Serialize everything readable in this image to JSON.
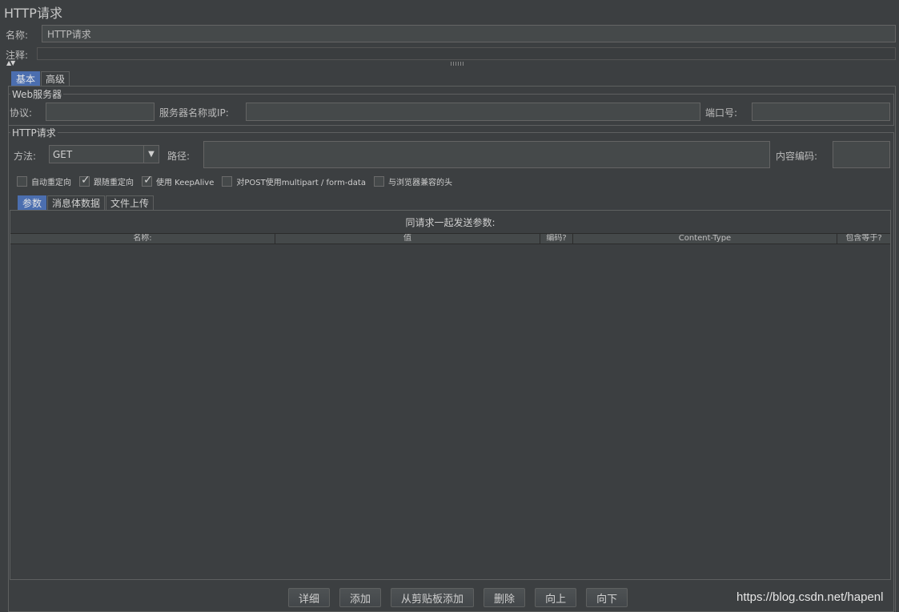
{
  "header": {
    "title": "HTTP请求"
  },
  "form": {
    "name_label": "名称:",
    "name_value": "HTTP请求",
    "comment_label": "注释:",
    "comment_value": ""
  },
  "tabs": [
    {
      "label": "基本",
      "active": true
    },
    {
      "label": "高级",
      "active": false
    }
  ],
  "web_server": {
    "title": "Web服务器",
    "protocol_label": "协议:",
    "protocol_value": "",
    "server_label": "服务器名称或IP:",
    "server_value": "",
    "port_label": "端口号:",
    "port_value": ""
  },
  "http_request": {
    "title": "HTTP请求",
    "method_label": "方法:",
    "method_value": "GET",
    "path_label": "路径:",
    "path_value": "",
    "encoding_label": "内容编码:",
    "encoding_value": ""
  },
  "options": [
    {
      "label": "自动重定向",
      "checked": false
    },
    {
      "label": "跟随重定向",
      "checked": true
    },
    {
      "label": "使用 KeepAlive",
      "checked": true
    },
    {
      "label": "对POST使用multipart / form-data",
      "checked": false
    },
    {
      "label": "与浏览器兼容的头",
      "checked": false
    }
  ],
  "subtabs": [
    {
      "label": "参数",
      "active": true
    },
    {
      "label": "消息体数据",
      "active": false
    },
    {
      "label": "文件上传",
      "active": false
    }
  ],
  "params": {
    "caption": "同请求一起发送参数:",
    "columns": [
      "名称:",
      "值",
      "编码?",
      "Content-Type",
      "包含等于?"
    ],
    "rows": []
  },
  "buttons": {
    "detail": "详细",
    "add": "添加",
    "add_clipboard": "从剪贴板添加",
    "delete": "删除",
    "up": "向上",
    "down": "向下"
  },
  "watermark": "https://blog.csdn.net/hapenl",
  "colors": {
    "background": "#3c3f41",
    "accent": "#4b6eaf",
    "field": "#45494a"
  }
}
